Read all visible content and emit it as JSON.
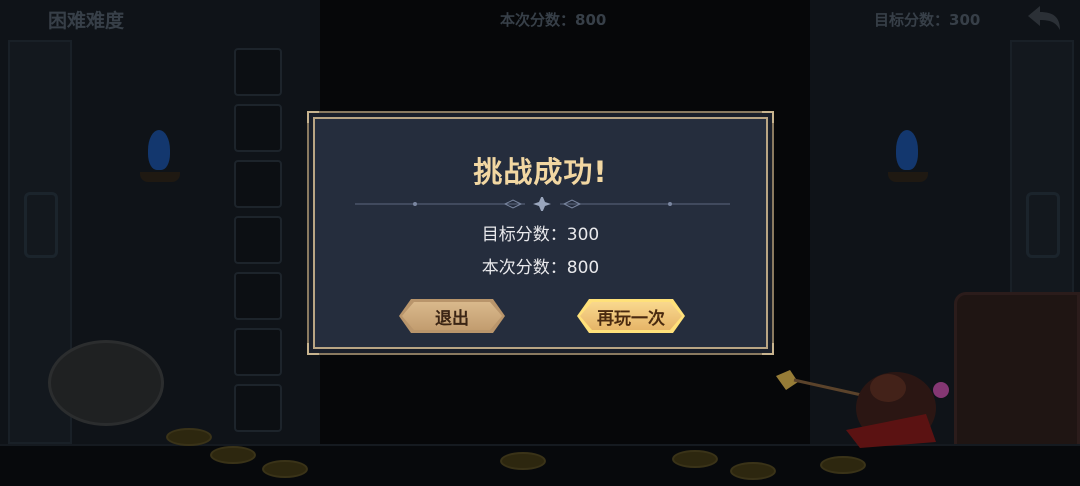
{
  "hud": {
    "difficulty": "困难难度",
    "current_score": "本次分数：800",
    "target_score": "目标分数：300"
  },
  "dialog": {
    "title": "挑战成功!",
    "target_line": "目标分数：300",
    "current_line": "本次分数：800",
    "exit_label": "退出",
    "replay_label": "再玩一次"
  },
  "colors": {
    "dialog_bg": "#252d3d",
    "title_gold": "#f2d7a2",
    "button_gold": "#e6b568"
  }
}
